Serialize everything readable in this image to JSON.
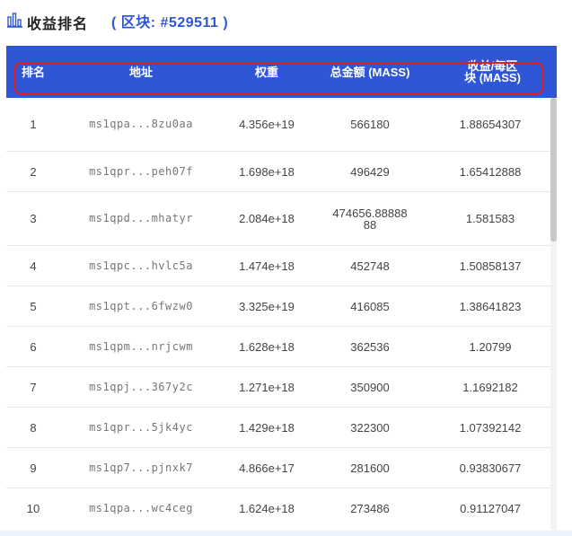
{
  "header": {
    "title": "收益排名",
    "block_label": "( 区块: #529511 )",
    "icon": "bar-chart-icon"
  },
  "table": {
    "columns": [
      "排名",
      "地址",
      "权重",
      "总金额 (MASS)",
      "收益/每区块 (MASS)"
    ],
    "rows": [
      {
        "rank": "1",
        "address": "ms1qpa...8zu0aa",
        "weight": "4.356e+19",
        "total": "566180",
        "per_block": "1.88654307"
      },
      {
        "rank": "2",
        "address": "ms1qpr...peh07f",
        "weight": "1.698e+18",
        "total": "496429",
        "per_block": "1.65412888"
      },
      {
        "rank": "3",
        "address": "ms1qpd...mhatyr",
        "weight": "2.084e+18",
        "total": "474656.8888888",
        "per_block": "1.581583"
      },
      {
        "rank": "4",
        "address": "ms1qpc...hvlc5a",
        "weight": "1.474e+18",
        "total": "452748",
        "per_block": "1.50858137"
      },
      {
        "rank": "5",
        "address": "ms1qpt...6fwzw0",
        "weight": "3.325e+19",
        "total": "416085",
        "per_block": "1.38641823"
      },
      {
        "rank": "6",
        "address": "ms1qpm...nrjcwm",
        "weight": "1.628e+18",
        "total": "362536",
        "per_block": "1.20799"
      },
      {
        "rank": "7",
        "address": "ms1qpj...367y2c",
        "weight": "1.271e+18",
        "total": "350900",
        "per_block": "1.1692182"
      },
      {
        "rank": "8",
        "address": "ms1qpr...5jk4yc",
        "weight": "1.429e+18",
        "total": "322300",
        "per_block": "1.07392142"
      },
      {
        "rank": "9",
        "address": "ms1qp7...pjnxk7",
        "weight": "4.866e+17",
        "total": "281600",
        "per_block": "0.93830677"
      },
      {
        "rank": "10",
        "address": "ms1qpa...wc4ceg",
        "weight": "1.624e+18",
        "total": "273486",
        "per_block": "0.91127047"
      }
    ]
  },
  "colors": {
    "header_bg": "#2f56d6",
    "highlight": "#e01e1e",
    "block_label": "#2f56d6"
  }
}
